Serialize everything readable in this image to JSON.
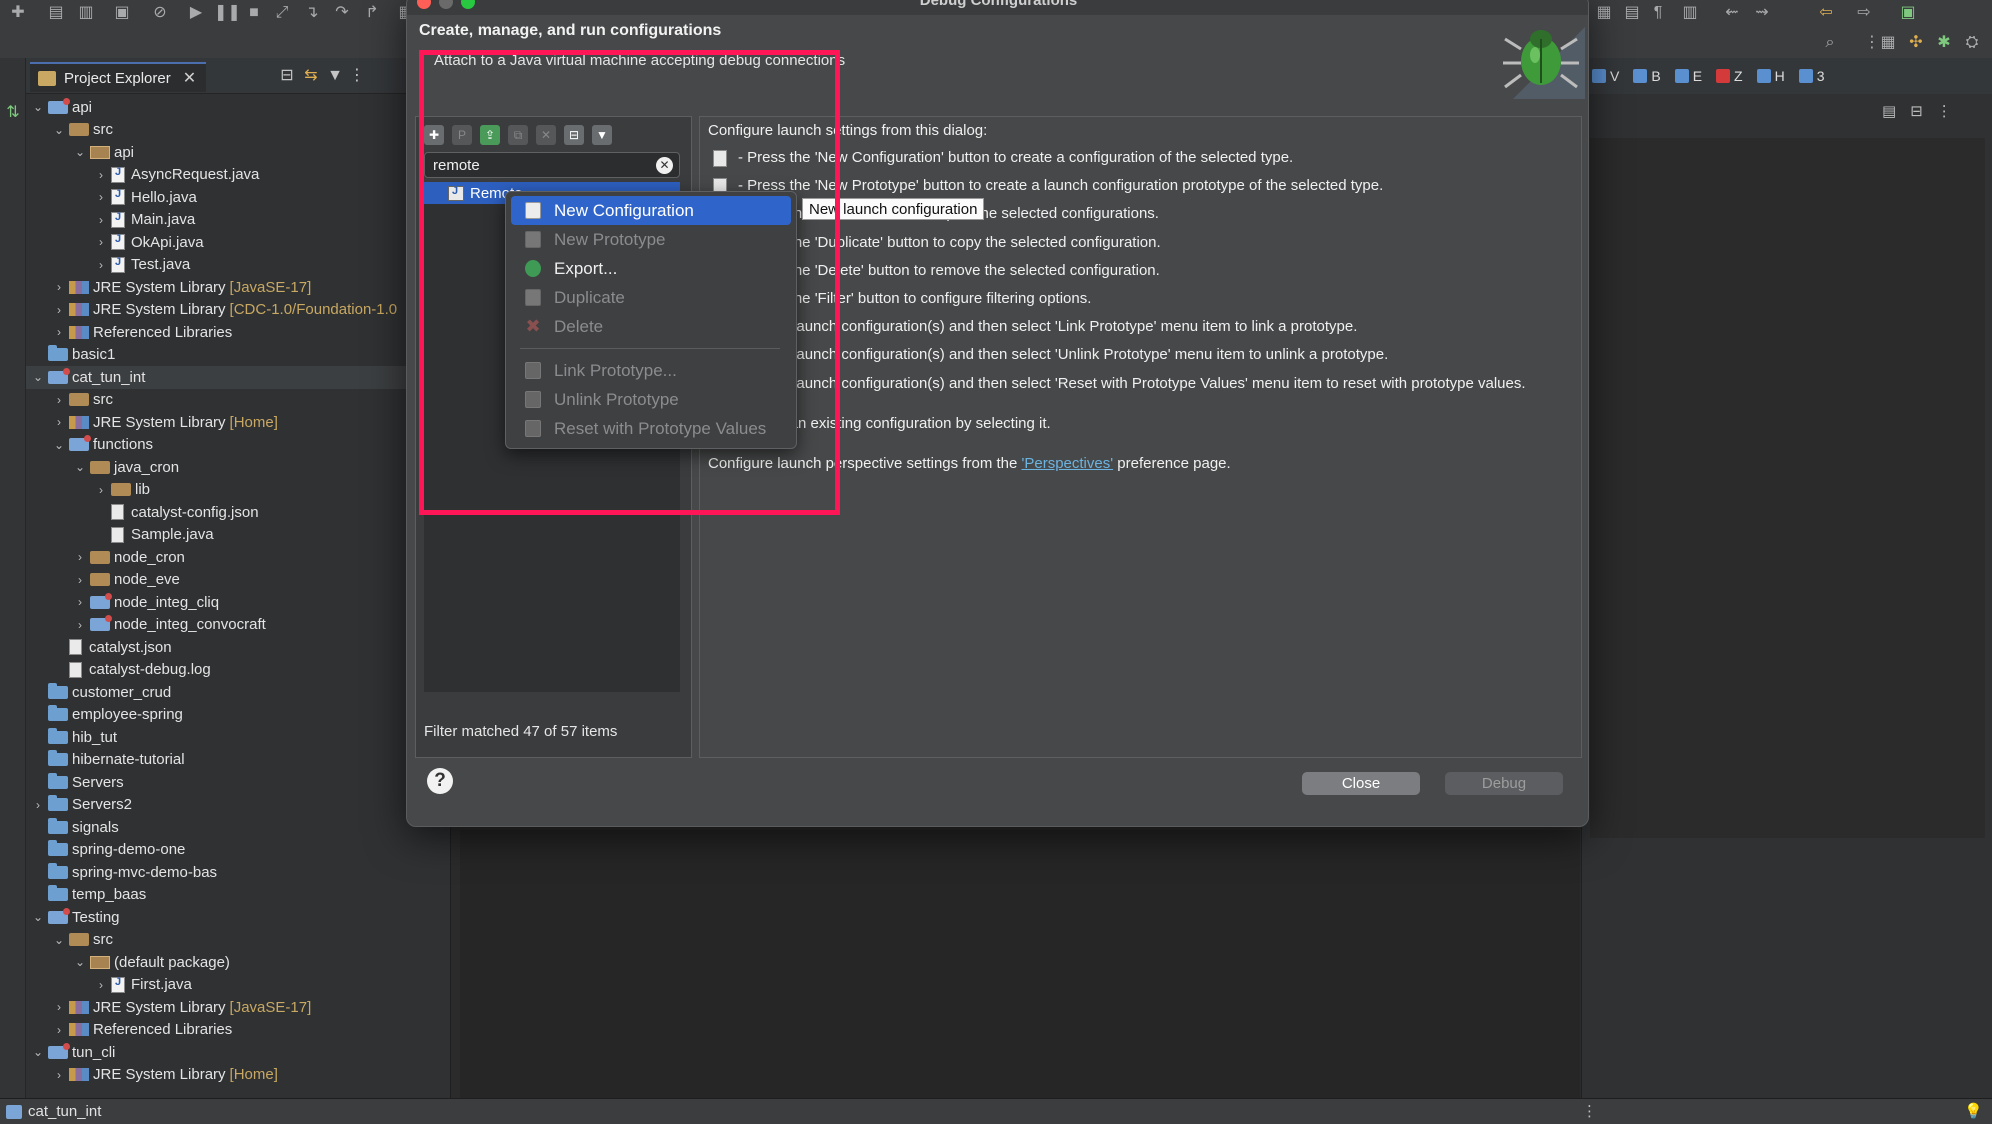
{
  "dialog": {
    "title": "Debug Configurations",
    "heading": "Create, manage, and run configurations",
    "subtitle": "Attach to a Java virtual machine accepting debug connections",
    "filter": {
      "value": "remote"
    },
    "selected_config": "Remote",
    "filter_status": "Filter matched 47 of 57 items",
    "instructions": {
      "intro": "Configure launch settings from this dialog:",
      "lines": [
        "- Press the 'New Configuration' button to create a configuration of the selected type.",
        "- Press the 'New Prototype' button to create a launch configuration prototype of the selected type.",
        "- Press the 'Export' button to export the selected configurations.",
        "- Press the 'Duplicate' button to copy the selected configuration.",
        "- Press the 'Delete' button to remove the selected configuration.",
        "- Press the 'Filter' button to configure filtering options.",
        "- Select launch configuration(s) and then select 'Link Prototype' menu item to link a prototype.",
        "- Select launch configuration(s) and then select 'Unlink Prototype' menu item to unlink a prototype.",
        "- Select launch configuration(s) and then select 'Reset with Prototype Values' menu item to reset with prototype values."
      ],
      "edit": "Edit or view an existing configuration by selecting it.",
      "perspective_pre": "Configure launch perspective settings from the ",
      "perspective_link": "'Perspectives'",
      "perspective_post": " preference page."
    },
    "buttons": {
      "close": "Close",
      "debug": "Debug",
      "help": "?"
    }
  },
  "context_menu": {
    "items": [
      {
        "label": "New Configuration",
        "enabled": true,
        "highlighted": true,
        "icon": "new-config-icon"
      },
      {
        "label": "New Prototype",
        "enabled": false,
        "icon": "new-prototype-icon"
      },
      {
        "label": "Export...",
        "enabled": true,
        "icon": "export-icon"
      },
      {
        "label": "Duplicate",
        "enabled": false,
        "icon": "duplicate-icon"
      },
      {
        "label": "Delete",
        "enabled": false,
        "icon": "delete-icon"
      },
      {
        "label": "Link Prototype...",
        "enabled": false,
        "icon": "link-prototype-icon"
      },
      {
        "label": "Unlink Prototype",
        "enabled": false,
        "icon": "unlink-prototype-icon"
      },
      {
        "label": "Reset with Prototype Values",
        "enabled": false,
        "icon": "reset-prototype-icon"
      }
    ]
  },
  "tooltip": "New launch configuration",
  "project_explorer": {
    "title": "Project Explorer",
    "tree": [
      {
        "label": "api",
        "depth": 0,
        "arrow": "open",
        "icon": "project"
      },
      {
        "label": "src",
        "depth": 1,
        "arrow": "open",
        "icon": "src"
      },
      {
        "label": "api",
        "depth": 2,
        "arrow": "open",
        "icon": "pkg"
      },
      {
        "label": "AsyncRequest.java",
        "depth": 3,
        "arrow": "closed",
        "icon": "java"
      },
      {
        "label": "Hello.java",
        "depth": 3,
        "arrow": "closed",
        "icon": "java"
      },
      {
        "label": "Main.java",
        "depth": 3,
        "arrow": "closed",
        "icon": "java"
      },
      {
        "label": "OkApi.java",
        "depth": 3,
        "arrow": "closed",
        "icon": "java"
      },
      {
        "label": "Test.java",
        "depth": 3,
        "arrow": "closed",
        "icon": "java"
      },
      {
        "label": "JRE System Library",
        "deco": "[JavaSE-17]",
        "depth": 1,
        "arrow": "closed",
        "icon": "lib"
      },
      {
        "label": "JRE System Library",
        "deco": "[CDC-1.0/Foundation-1.0",
        "depth": 1,
        "arrow": "closed",
        "icon": "lib"
      },
      {
        "label": "Referenced Libraries",
        "depth": 1,
        "arrow": "closed",
        "icon": "lib"
      },
      {
        "label": "basic1",
        "depth": 0,
        "arrow": "none",
        "icon": "folder"
      },
      {
        "label": "cat_tun_int",
        "depth": 0,
        "arrow": "open",
        "icon": "project",
        "selected": true
      },
      {
        "label": "src",
        "depth": 1,
        "arrow": "closed",
        "icon": "src"
      },
      {
        "label": "JRE System Library",
        "deco": "[Home]",
        "depth": 1,
        "arrow": "closed",
        "icon": "lib"
      },
      {
        "label": "functions",
        "depth": 1,
        "arrow": "open",
        "icon": "project"
      },
      {
        "label": "java_cron",
        "depth": 2,
        "arrow": "open",
        "icon": "src"
      },
      {
        "label": "lib",
        "depth": 3,
        "arrow": "closed",
        "icon": "src"
      },
      {
        "label": "catalyst-config.json",
        "depth": 3,
        "arrow": "none",
        "icon": "file"
      },
      {
        "label": "Sample.java",
        "depth": 3,
        "arrow": "none",
        "icon": "file"
      },
      {
        "label": "node_cron",
        "depth": 2,
        "arrow": "closed",
        "icon": "src"
      },
      {
        "label": "node_eve",
        "depth": 2,
        "arrow": "closed",
        "icon": "src"
      },
      {
        "label": "node_integ_cliq",
        "depth": 2,
        "arrow": "closed",
        "icon": "project"
      },
      {
        "label": "node_integ_convocraft",
        "depth": 2,
        "arrow": "closed",
        "icon": "project"
      },
      {
        "label": "catalyst.json",
        "depth": 1,
        "arrow": "none",
        "icon": "file"
      },
      {
        "label": "catalyst-debug.log",
        "depth": 1,
        "arrow": "none",
        "icon": "file"
      },
      {
        "label": "customer_crud",
        "depth": 0,
        "arrow": "none",
        "icon": "folder"
      },
      {
        "label": "employee-spring",
        "depth": 0,
        "arrow": "none",
        "icon": "folder"
      },
      {
        "label": "hib_tut",
        "depth": 0,
        "arrow": "none",
        "icon": "folder"
      },
      {
        "label": "hibernate-tutorial",
        "depth": 0,
        "arrow": "none",
        "icon": "folder"
      },
      {
        "label": "Servers",
        "depth": 0,
        "arrow": "none",
        "icon": "folder"
      },
      {
        "label": "Servers2",
        "depth": 0,
        "arrow": "closed",
        "icon": "folder"
      },
      {
        "label": "signals",
        "depth": 0,
        "arrow": "none",
        "icon": "folder"
      },
      {
        "label": "spring-demo-one",
        "depth": 0,
        "arrow": "none",
        "icon": "folder"
      },
      {
        "label": "spring-mvc-demo-bas",
        "depth": 0,
        "arrow": "none",
        "icon": "folder"
      },
      {
        "label": "temp_baas",
        "depth": 0,
        "arrow": "none",
        "icon": "folder"
      },
      {
        "label": "Testing",
        "depth": 0,
        "arrow": "open",
        "icon": "project"
      },
      {
        "label": "src",
        "depth": 1,
        "arrow": "open",
        "icon": "src"
      },
      {
        "label": "(default package)",
        "depth": 2,
        "arrow": "open",
        "icon": "pkg"
      },
      {
        "label": "First.java",
        "depth": 3,
        "arrow": "closed",
        "icon": "java"
      },
      {
        "label": "JRE System Library",
        "deco": "[JavaSE-17]",
        "depth": 1,
        "arrow": "closed",
        "icon": "lib"
      },
      {
        "label": "Referenced Libraries",
        "depth": 1,
        "arrow": "closed",
        "icon": "lib"
      },
      {
        "label": "tun_cli",
        "depth": 0,
        "arrow": "open",
        "icon": "project"
      },
      {
        "label": "JRE System Library",
        "deco": "[Home]",
        "depth": 1,
        "arrow": "closed",
        "icon": "lib"
      }
    ]
  },
  "right_tabs": [
    {
      "label": "V",
      "icon": "variables-icon"
    },
    {
      "label": "B",
      "icon": "breakpoints-icon"
    },
    {
      "label": "E",
      "icon": "expressions-icon"
    },
    {
      "label": "Z",
      "icon": "z-icon",
      "red": true
    },
    {
      "label": "H",
      "icon": "h-icon"
    },
    {
      "label": "3",
      "icon": "more-views-icon"
    }
  ],
  "statusbar": {
    "text": "cat_tun_int"
  },
  "annotation": {
    "color": "#ff1656"
  }
}
